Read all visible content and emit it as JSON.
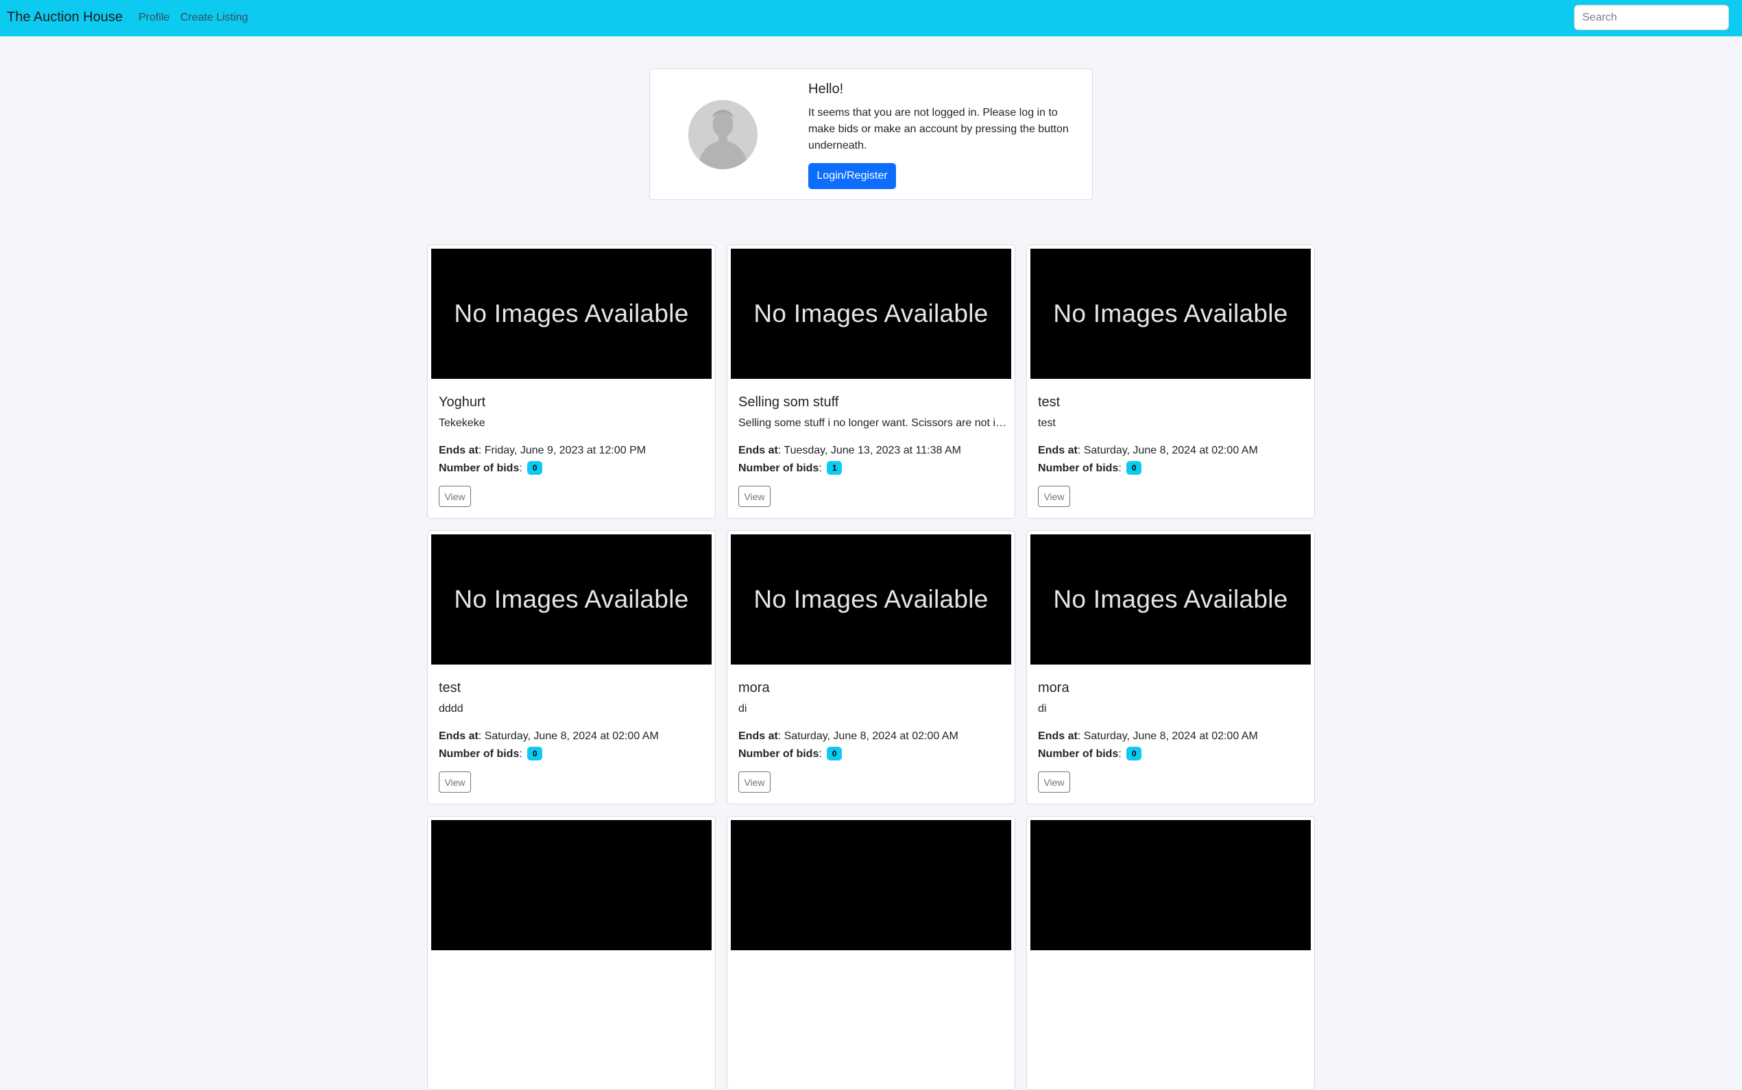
{
  "navbar": {
    "brand": "The Auction House",
    "links": [
      "Profile",
      "Create Listing"
    ],
    "search_placeholder": "Search"
  },
  "login_card": {
    "title": "Hello!",
    "message": "It seems that you are not logged in. Please log in to make bids or make an account by pressing the button underneath.",
    "button_label": "Login/Register",
    "avatar_icon": "user-silhouette-icon"
  },
  "labels": {
    "ends_at": "Ends at",
    "number_of_bids": "Number of bids",
    "view": "View",
    "no_images": "No Images Available"
  },
  "listings": [
    {
      "title": "Yoghurt",
      "description": "Tekekeke",
      "ends_at": "Friday, June 9, 2023 at 12:00 PM",
      "bids": "0"
    },
    {
      "title": "Selling som stuff",
      "description": "Selling some stuff i no longer want. Scissors are not included.",
      "ends_at": "Tuesday, June 13, 2023 at 11:38 AM",
      "bids": "1"
    },
    {
      "title": "test",
      "description": "test",
      "ends_at": "Saturday, June 8, 2024 at 02:00 AM",
      "bids": "0"
    },
    {
      "title": "test",
      "description": "dddd",
      "ends_at": "Saturday, June 8, 2024 at 02:00 AM",
      "bids": "0"
    },
    {
      "title": "mora",
      "description": "di",
      "ends_at": "Saturday, June 8, 2024 at 02:00 AM",
      "bids": "0"
    },
    {
      "title": "mora",
      "description": "di",
      "ends_at": "Saturday, June 8, 2024 at 02:00 AM",
      "bids": "0"
    }
  ],
  "colors": {
    "navbar": "#0dcaf0",
    "primary_button": "#0d6efd",
    "badge": "#0dcaf0",
    "page_background": "#f4f6f9"
  }
}
